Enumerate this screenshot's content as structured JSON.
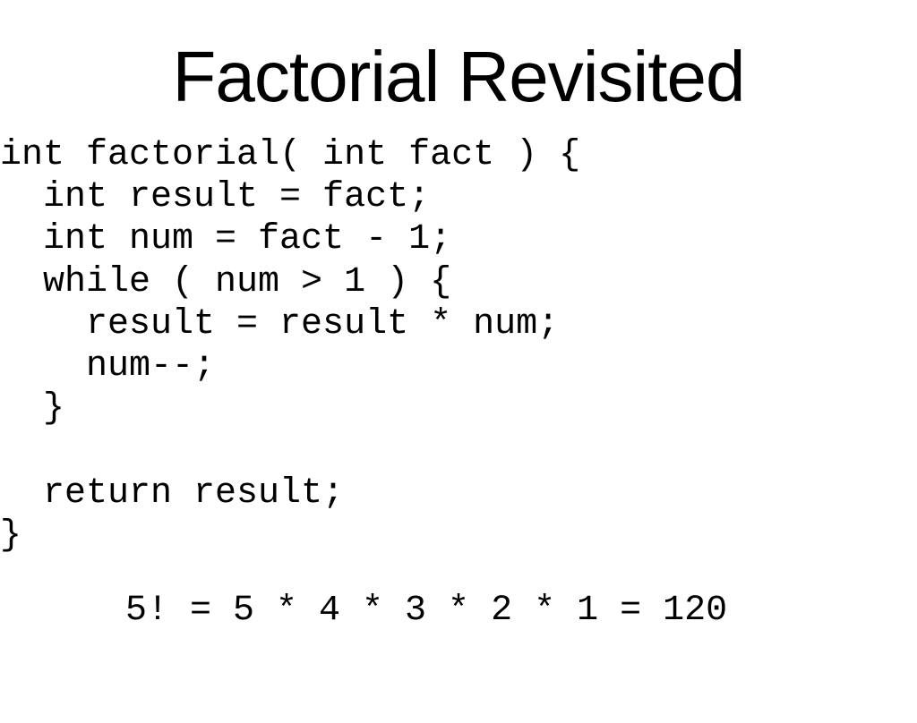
{
  "title": "Factorial Revisited",
  "code": "int factorial( int fact ) {\n  int result = fact;\n  int num = fact - 1;\n  while ( num > 1 ) {\n    result = result * num;\n    num--;\n  }\n\n  return result;\n}",
  "equation": "5! = 5 * 4 * 3 * 2 * 1 = 120"
}
